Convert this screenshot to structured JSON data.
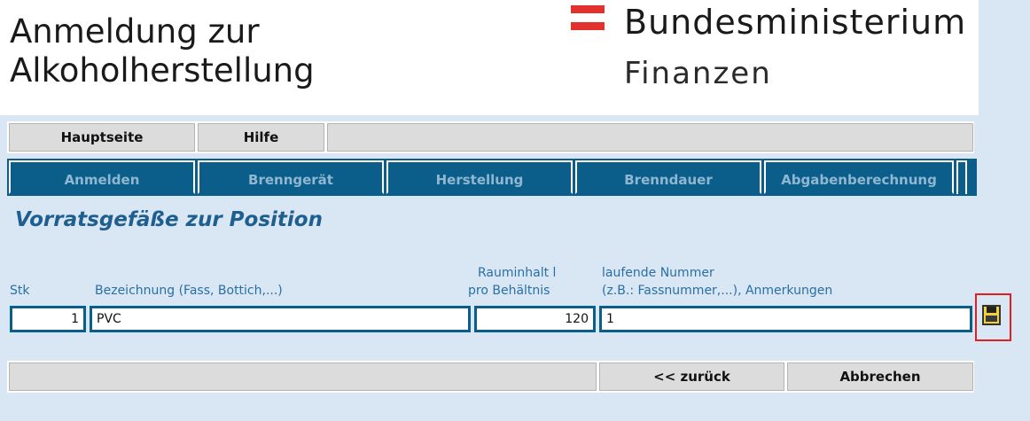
{
  "header": {
    "title": "Anmeldung zur\nAlkoholherstellung",
    "ministry_line1": "Bundesministerium",
    "ministry_line2": "Finanzen",
    "flag_color": "#e3312d"
  },
  "topnav": {
    "items": [
      {
        "label": "Hauptseite"
      },
      {
        "label": "Hilfe"
      }
    ]
  },
  "steps": [
    {
      "label": "Anmelden"
    },
    {
      "label": "Brenngerät"
    },
    {
      "label": "Herstellung"
    },
    {
      "label": "Brenndauer"
    },
    {
      "label": "Abgabenberechnung"
    }
  ],
  "section": {
    "title": "Vorratsgefäße zur Position"
  },
  "columns": {
    "stk": "Stk",
    "bezeichnung": "Bezeichnung (Fass, Bottich,...)",
    "rauminhalt_line1": "Rauminhalt l",
    "rauminhalt_line2": "pro Behältnis",
    "nummer_line1": "laufende Nummer",
    "nummer_line2": "(z.B.: Fassnummer,...), Anmerkungen"
  },
  "row": {
    "stk": "1",
    "bezeichnung": "PVC",
    "rauminhalt": "120",
    "nummer": "1"
  },
  "actions": {
    "back_label": "<< zurück",
    "cancel_label": "Abbrechen",
    "save_icon": "floppy-disk-icon"
  },
  "colors": {
    "nav_blue": "#0c5e8a",
    "page_bg": "#d9e7f5",
    "highlight": "#e02020"
  }
}
